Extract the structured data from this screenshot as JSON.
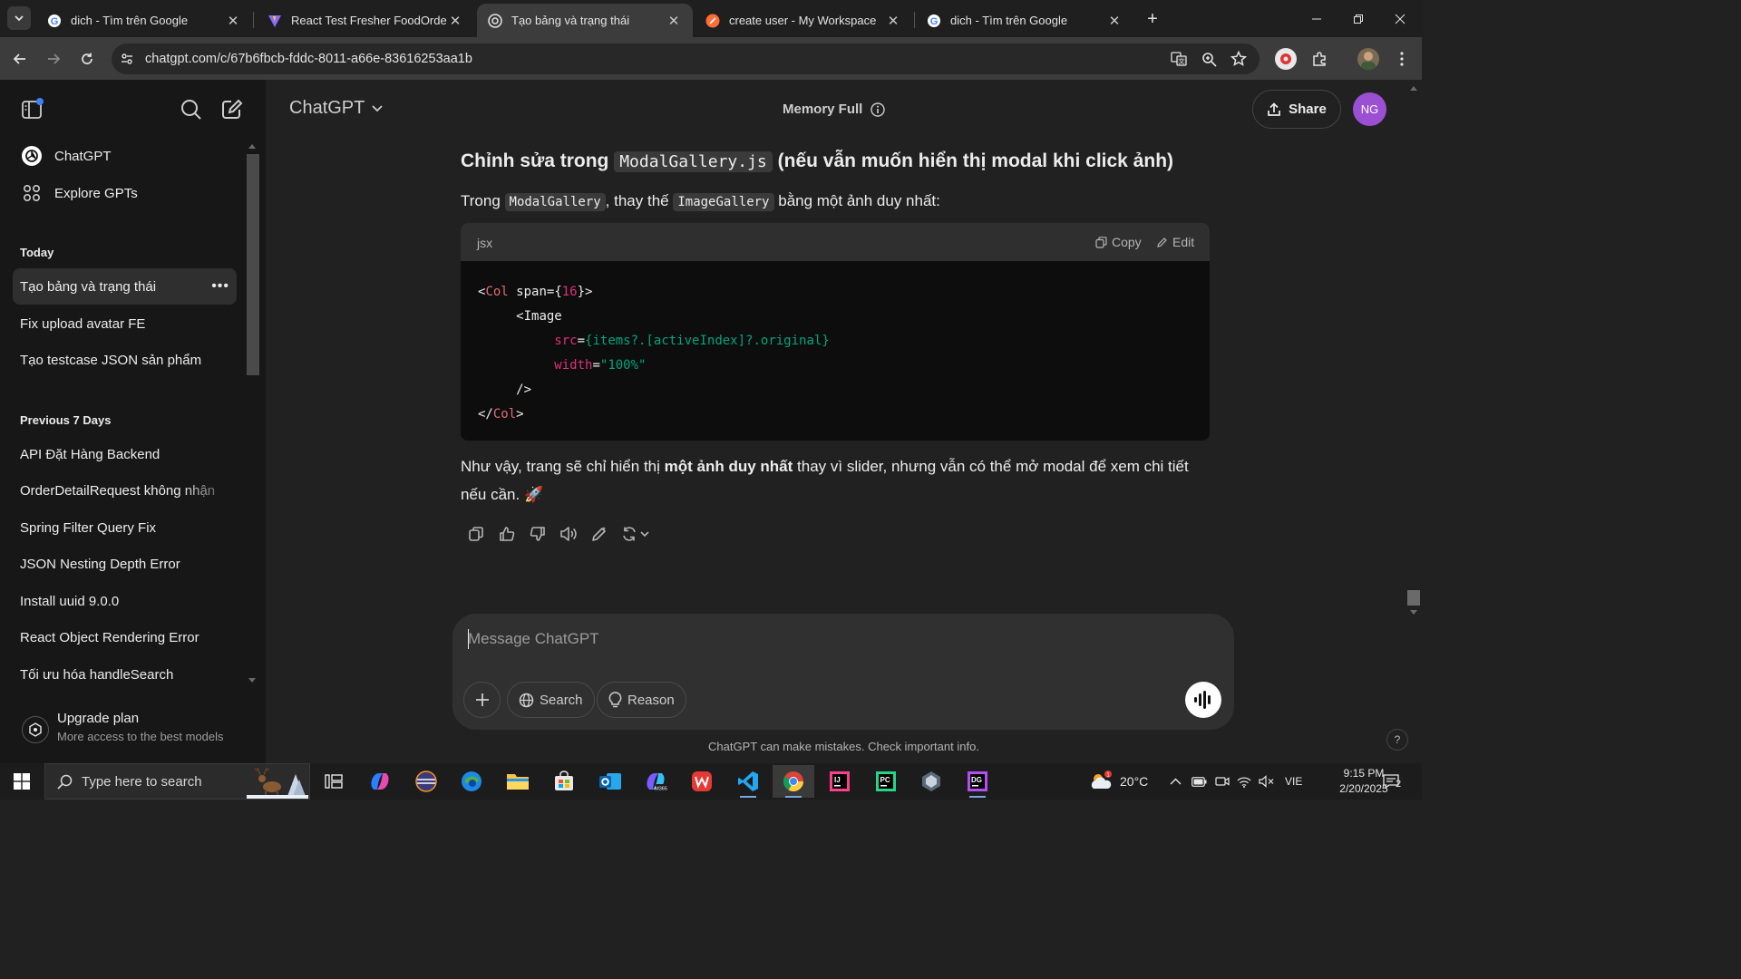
{
  "browser": {
    "tabs": [
      {
        "title": "dich - Tìm trên Google",
        "favicon": "google-icon",
        "active": false
      },
      {
        "title": "React Test Fresher FoodOrder",
        "favicon": "vite-icon",
        "active": false
      },
      {
        "title": "Tạo bảng và trạng thái",
        "favicon": "chatgpt-icon",
        "active": true
      },
      {
        "title": "create user - My Workspace",
        "favicon": "postman-icon",
        "active": false
      },
      {
        "title": "dich - Tìm trên Google",
        "favicon": "google-icon",
        "active": false
      }
    ],
    "url": "chatgpt.com/c/67b6fbcb-fddc-8011-a66e-83616253aa1b"
  },
  "sidebar": {
    "links": [
      {
        "label": "ChatGPT",
        "icon": "chatgpt-logo-icon"
      },
      {
        "label": "Explore GPTs",
        "icon": "grid-icon"
      }
    ],
    "today_label": "Today",
    "today": [
      {
        "label": "Tạo bảng và trạng thái",
        "active": true
      },
      {
        "label": "Fix upload avatar FE"
      },
      {
        "label": "Tạo testcase JSON sản phẩm"
      }
    ],
    "prev7_label": "Previous 7 Days",
    "prev7": [
      {
        "label": "API Đặt Hàng Backend"
      },
      {
        "label": "OrderDetailRequest không nhận"
      },
      {
        "label": "Spring Filter Query Fix"
      },
      {
        "label": "JSON Nesting Depth Error"
      },
      {
        "label": "Install uuid 9.0.0"
      },
      {
        "label": "React Object Rendering Error"
      },
      {
        "label": "Tối ưu hóa handleSearch"
      }
    ],
    "upgrade": {
      "title": "Upgrade plan",
      "subtitle": "More access to the best models"
    }
  },
  "header": {
    "model": "ChatGPT",
    "memory": "Memory Full",
    "share": "Share",
    "avatar": "NG"
  },
  "message": {
    "heading_pre": "Chỉnh sửa trong",
    "heading_code": "ModalGallery.js",
    "heading_post": "(nếu vẫn muốn hiển thị modal khi click ảnh)",
    "intro_a": "Trong",
    "intro_code1": "ModalGallery",
    "intro_b": ", thay thế",
    "intro_code2": "ImageGallery",
    "intro_c": "bằng một ảnh duy nhất:",
    "code_lang": "jsx",
    "copy": "Copy",
    "edit": "Edit",
    "code": {
      "l1_open": "<",
      "l1_tag": "Col",
      "l1_attr": " span=",
      "l1_brace_open": "{",
      "l1_num": "16",
      "l1_brace_close": "}>",
      "l2": "<Image",
      "l3_attr": "src",
      "l3_eq": "=",
      "l3_val": "{items?.[activeIndex]?.original}",
      "l4_attr": "width",
      "l4_eq": "=",
      "l4_val": "\"100%\"",
      "l5": "/>",
      "l6_open": "</",
      "l6_tag": "Col",
      "l6_close": ">"
    },
    "outro_a": "Như vậy, trang sẽ chỉ hiển thị",
    "outro_bold": "một ảnh duy nhất",
    "outro_b": "thay vì slider, nhưng vẫn có thể mở modal để xem chi tiết nếu cần.",
    "outro_emoji": "🚀"
  },
  "composer": {
    "placeholder": "Message ChatGPT",
    "search": "Search",
    "reason": "Reason"
  },
  "disclaimer": "ChatGPT can make mistakes. Check important info.",
  "taskbar": {
    "search_placeholder": "Type here to search",
    "weather": "20°C",
    "lang": "VIE",
    "time": "9:15 PM",
    "date": "2/20/2025",
    "notifications": "2"
  }
}
